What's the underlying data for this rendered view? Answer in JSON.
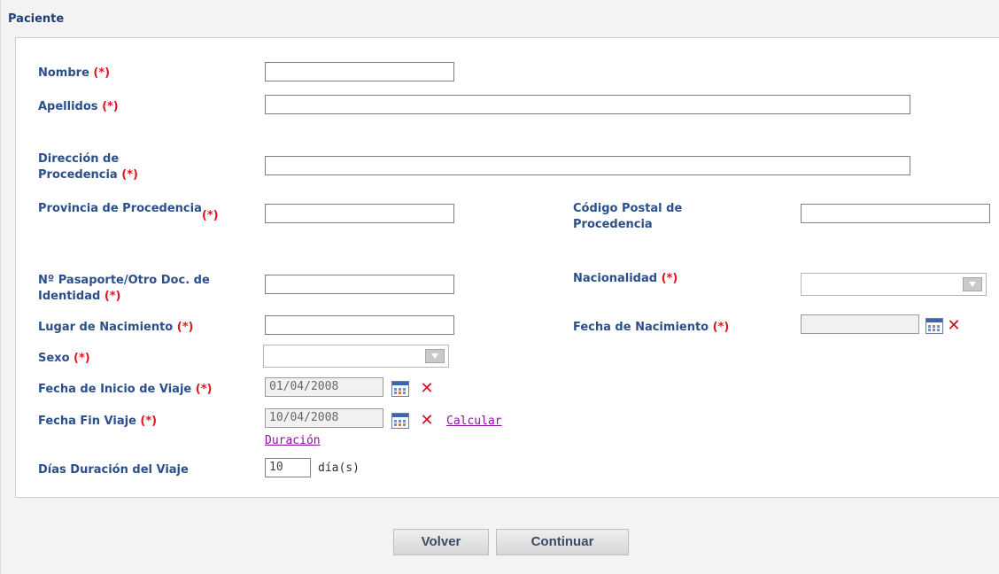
{
  "section": {
    "title": "Paciente"
  },
  "required_marker": "(*)",
  "fields": {
    "nombre": {
      "label": "Nombre",
      "value": ""
    },
    "apellidos": {
      "label": "Apellidos",
      "value": ""
    },
    "direccion": {
      "label_line1": "Dirección de",
      "label_line2": "Procedencia",
      "value": ""
    },
    "provincia": {
      "label": "Provincia de Procedencia",
      "value": ""
    },
    "codigo_postal": {
      "label_line1": "Código Postal de",
      "label_line2": "Procedencia",
      "value": ""
    },
    "pasaporte": {
      "label_line1": "Nº Pasaporte/Otro Doc. de",
      "label_line2": "Identidad",
      "value": ""
    },
    "nacionalidad": {
      "label": "Nacionalidad",
      "selected": ""
    },
    "lugar_nacimiento": {
      "label": "Lugar de Nacimiento",
      "value": ""
    },
    "fecha_nacimiento": {
      "label": "Fecha de Nacimiento",
      "value": ""
    },
    "sexo": {
      "label": "Sexo",
      "selected": ""
    },
    "fecha_inicio": {
      "label": "Fecha de Inicio de Viaje",
      "value": "01/04/2008"
    },
    "fecha_fin": {
      "label": "Fecha Fin Viaje",
      "value": "10/04/2008"
    },
    "calcular_link": {
      "line1": "Calcular",
      "line2": "Duración"
    },
    "dias_duracion": {
      "label": "Días Duración del Viaje",
      "value": "10",
      "unit": "día(s)"
    }
  },
  "buttons": {
    "volver": "Volver",
    "continuar": "Continuar"
  },
  "icons": {
    "calendar": "calendar-icon",
    "clear": "clear-x-icon",
    "dropdown": "dropdown-arrow-icon"
  },
  "colors": {
    "label": "#2b4f8a",
    "required": "#e0141e",
    "link": "#8b0fa0",
    "clear": "#cc1020"
  }
}
